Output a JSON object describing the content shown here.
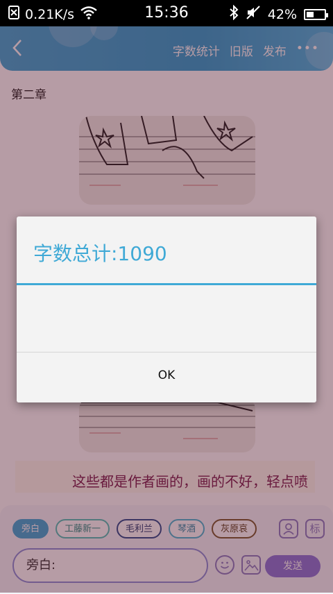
{
  "status_bar": {
    "net_speed": "0.21K/s",
    "time": "15:36",
    "battery_percent": "42%",
    "battery_level": 0.42
  },
  "header": {
    "actions": [
      "字数统计",
      "旧版",
      "发布"
    ],
    "more": "•••"
  },
  "content": {
    "chapter_title": "第二章",
    "caption": "这些都是作者画的，画的不好，轻点喷"
  },
  "composer": {
    "roles": [
      "旁白",
      "工藤新一",
      "毛利兰",
      "琴酒",
      "灰原哀"
    ],
    "active_role": "旁白",
    "tool_mark": "标",
    "input_value": "旁白:",
    "send_label": "发送"
  },
  "dialog": {
    "title": "字数总计:1090",
    "ok_label": "OK"
  },
  "colors": {
    "accent": "#3fa9d6",
    "caption": "#7a1e4d",
    "send": "#8a78d8"
  }
}
